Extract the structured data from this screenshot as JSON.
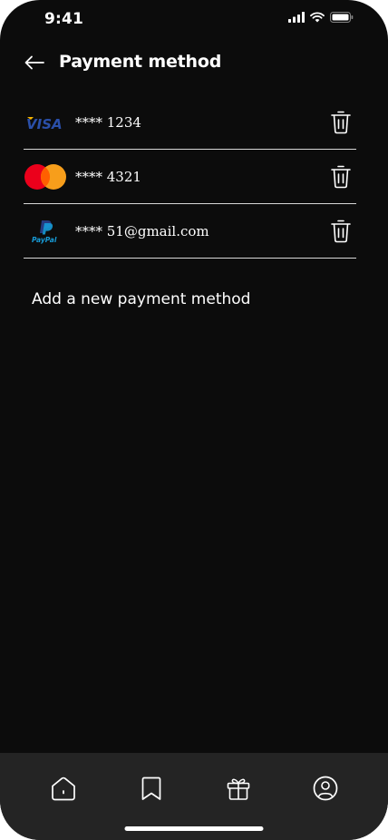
{
  "status_bar": {
    "time": "9:41",
    "icons": [
      "cellular-signal-icon",
      "wifi-icon",
      "battery-icon"
    ]
  },
  "header": {
    "back_icon": "arrow-left-icon",
    "title": "Payment method"
  },
  "payment_methods": [
    {
      "brand": "visa",
      "logo_icon": "visa-logo",
      "logo_text": "VISA",
      "masked": "**** 1234",
      "delete_icon": "trash-icon"
    },
    {
      "brand": "mastercard",
      "logo_icon": "mastercard-logo",
      "masked": "**** 4321",
      "delete_icon": "trash-icon"
    },
    {
      "brand": "paypal",
      "logo_icon": "paypal-logo",
      "logo_text": "PayPal",
      "masked": "**** 51@gmail.com",
      "delete_icon": "trash-icon"
    }
  ],
  "add_payment_label": "Add a new payment method",
  "bottom_nav": {
    "items": [
      {
        "icon": "home-icon"
      },
      {
        "icon": "bookmark-icon"
      },
      {
        "icon": "gift-icon"
      },
      {
        "icon": "profile-icon"
      }
    ]
  },
  "colors": {
    "background": "#0c0c0c",
    "nav_background": "#242424",
    "text": "#ffffff",
    "divider": "#d8d8d8",
    "visa_blue": "#1a1f71",
    "visa_gold": "#f7b600",
    "mastercard_red": "#eb001b",
    "mastercard_orange": "#f79e1b",
    "paypal_dark": "#253b80",
    "paypal_light": "#179bd7"
  }
}
